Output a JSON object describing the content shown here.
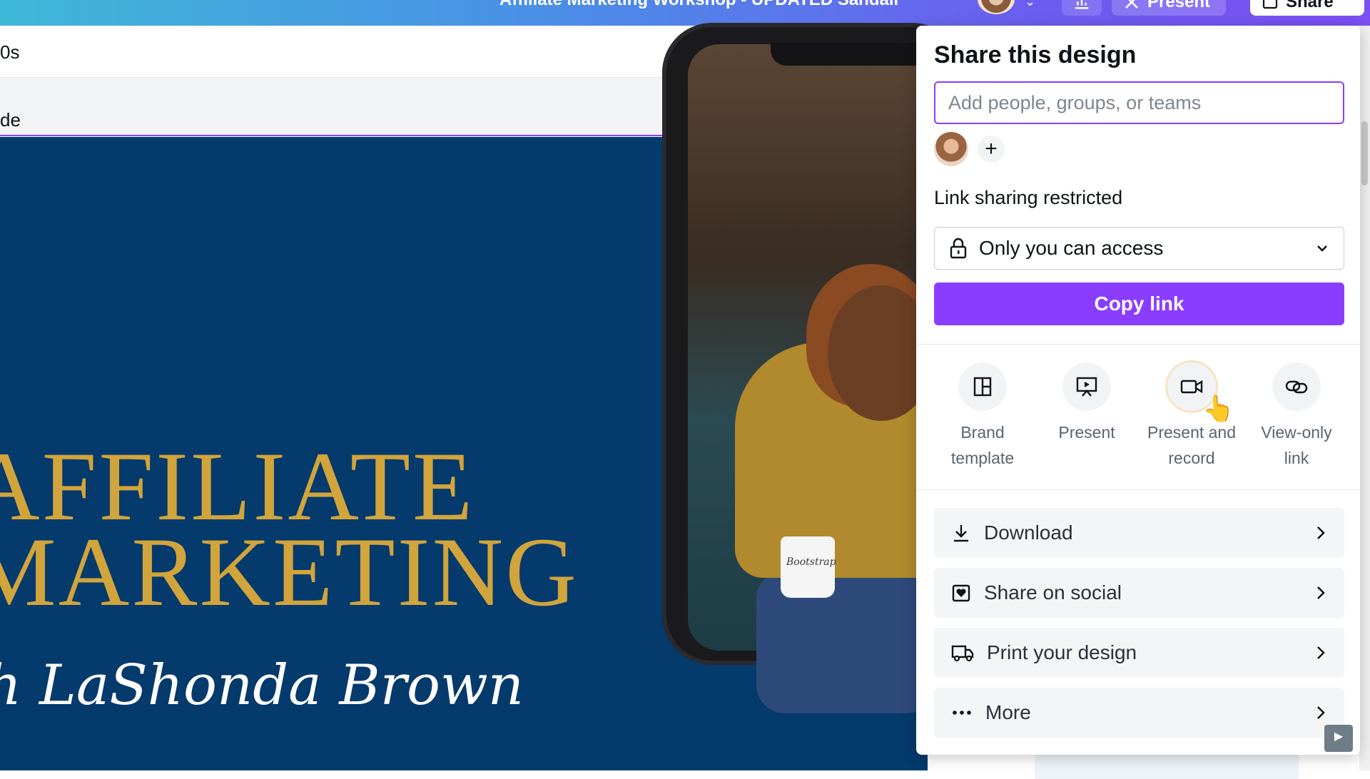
{
  "header": {
    "doc_title": "Affiliate Marketing Workshop - UPDATED Sandall",
    "present_label": "Present",
    "share_label": "Share"
  },
  "toolbar": {
    "partial_text": "0s"
  },
  "subbar": {
    "partial_text": "de"
  },
  "design": {
    "headline_line1": "AFFILIATE",
    "headline_line2": "MARKETING",
    "script_text": "h LaShonda Brown",
    "mug_text": "Bootstrap",
    "headline_color": "#d2a43c",
    "background_color": "#043a6c"
  },
  "share_panel": {
    "title": "Share this design",
    "people_placeholder": "Add people, groups, or teams",
    "link_sharing_label": "Link sharing restricted",
    "access_value": "Only you can access",
    "copy_link_label": "Copy link",
    "accent_color": "#8b3dff",
    "share_options": [
      {
        "label_line1": "Brand",
        "label_line2": "template",
        "icon": "brand-template-icon"
      },
      {
        "label_line1": "Present",
        "label_line2": "",
        "icon": "present-icon"
      },
      {
        "label_line1": "Present and",
        "label_line2": "record",
        "icon": "camera-icon"
      },
      {
        "label_line1": "View-only",
        "label_line2": "link",
        "icon": "link-icon"
      }
    ],
    "actions": [
      {
        "label": "Download",
        "icon": "download-icon"
      },
      {
        "label": "Share on social",
        "icon": "heart-icon"
      },
      {
        "label": "Print your design",
        "icon": "truck-icon"
      },
      {
        "label": "More",
        "icon": "more-icon"
      }
    ]
  }
}
